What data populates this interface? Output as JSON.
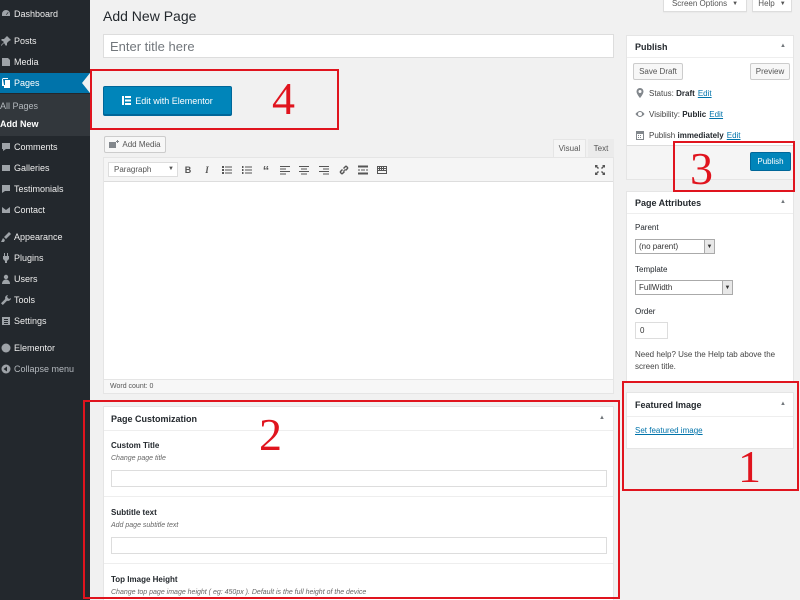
{
  "sidebar": {
    "items": [
      {
        "label": "Dashboard",
        "icon": "dashboard-icon"
      },
      {
        "label": "Posts",
        "icon": "pin-icon"
      },
      {
        "label": "Media",
        "icon": "media-icon"
      },
      {
        "label": "Pages",
        "icon": "pages-icon"
      },
      {
        "label": "Comments",
        "icon": "comment-icon"
      },
      {
        "label": "Galleries",
        "icon": "gallery-icon"
      },
      {
        "label": "Testimonials",
        "icon": "testimonial-icon"
      },
      {
        "label": "Contact",
        "icon": "mail-icon"
      },
      {
        "label": "Appearance",
        "icon": "brush-icon"
      },
      {
        "label": "Plugins",
        "icon": "plugin-icon"
      },
      {
        "label": "Users",
        "icon": "user-icon"
      },
      {
        "label": "Tools",
        "icon": "wrench-icon"
      },
      {
        "label": "Settings",
        "icon": "settings-icon"
      },
      {
        "label": "Elementor",
        "icon": "elementor-icon"
      },
      {
        "label": "Collapse menu",
        "icon": "collapse-icon"
      }
    ],
    "submenu": [
      "All Pages",
      "Add New"
    ]
  },
  "header": {
    "title": "Add New Page",
    "screen_options": "Screen Options",
    "help": "Help"
  },
  "title_input": {
    "placeholder": "Enter title here",
    "value": ""
  },
  "elementor_button": "Edit with Elementor",
  "editor": {
    "add_media": "Add Media",
    "tab_visual": "Visual",
    "tab_text": "Text",
    "format": "Paragraph",
    "word_count": "Word count: 0",
    "toolbar_icons": [
      "bold-icon",
      "italic-icon",
      "bullet-list-icon",
      "numbered-list-icon",
      "blockquote-icon",
      "align-left-icon",
      "align-center-icon",
      "align-right-icon",
      "link-icon",
      "read-more-icon",
      "toolbar-toggle-icon",
      "fullscreen-icon"
    ]
  },
  "publish": {
    "title": "Publish",
    "save_draft": "Save Draft",
    "preview": "Preview",
    "status_label": "Status:",
    "status_value": "Draft",
    "visibility_label": "Visibility:",
    "visibility_value": "Public",
    "schedule_label": "Publish",
    "schedule_value": "immediately",
    "edit": "Edit",
    "publish_button": "Publish"
  },
  "attributes": {
    "title": "Page Attributes",
    "parent_label": "Parent",
    "parent_value": "(no parent)",
    "template_label": "Template",
    "template_value": "FullWidth",
    "order_label": "Order",
    "order_value": "0",
    "help": "Need help? Use the Help tab above the screen title."
  },
  "featured": {
    "title": "Featured Image",
    "link": "Set featured image"
  },
  "customization": {
    "title": "Page Customization",
    "fields": [
      {
        "label": "Custom Title",
        "desc": "Change page title"
      },
      {
        "label": "Subtitle text",
        "desc": "Add page subtitle text"
      },
      {
        "label": "Top Image Height",
        "desc": "Change top page image height ( eg: 450px ). Default is the full height of the device"
      }
    ]
  },
  "annotations": {
    "one": "1",
    "two": "2",
    "three": "3",
    "four": "4",
    "color": "#e0141e"
  },
  "colors": {
    "sidebar_bg": "#23282d",
    "accent": "#0073aa",
    "primary_button": "#0085ba"
  }
}
